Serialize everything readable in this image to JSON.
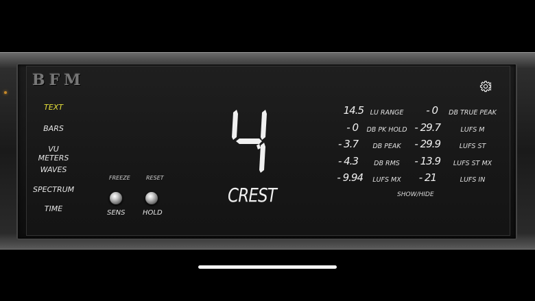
{
  "logo": "BFM",
  "menu": [
    {
      "label": "TEXT",
      "active": true
    },
    {
      "label": "BARS",
      "active": false
    },
    {
      "label": "VU METERS",
      "active": false
    },
    {
      "label": "WAVES",
      "active": false
    },
    {
      "label": "SPECTRUM",
      "active": false
    },
    {
      "label": "TIME",
      "active": false
    }
  ],
  "controls": {
    "freeze_label": "FREEZE",
    "reset_label": "RESET",
    "sens_label": "SENS",
    "hold_label": "HOLD"
  },
  "main_readout": {
    "value": "4",
    "label": "CREST"
  },
  "meters_left": [
    {
      "value": "14.5",
      "label": "LU RANGE"
    },
    {
      "value": "- 0",
      "label": "DB PK HOLD"
    },
    {
      "value": "- 3.7",
      "label": "DB PEAK"
    },
    {
      "value": "- 4.3",
      "label": "DB RMS"
    },
    {
      "value": "- 9.94",
      "label": "LUFS MX"
    }
  ],
  "meters_right": [
    {
      "value": "- 0",
      "label": "DB TRUE PEAK"
    },
    {
      "value": "- 29.7",
      "label": "LUFS M"
    },
    {
      "value": "- 29.9",
      "label": "LUFS ST"
    },
    {
      "value": "- 13.9",
      "label": "LUFS ST MX"
    },
    {
      "value": "- 21",
      "label": "LUFS IN"
    }
  ],
  "show_hide_label": "SHOW/HIDE",
  "icons": {
    "settings": "gear-icon"
  }
}
